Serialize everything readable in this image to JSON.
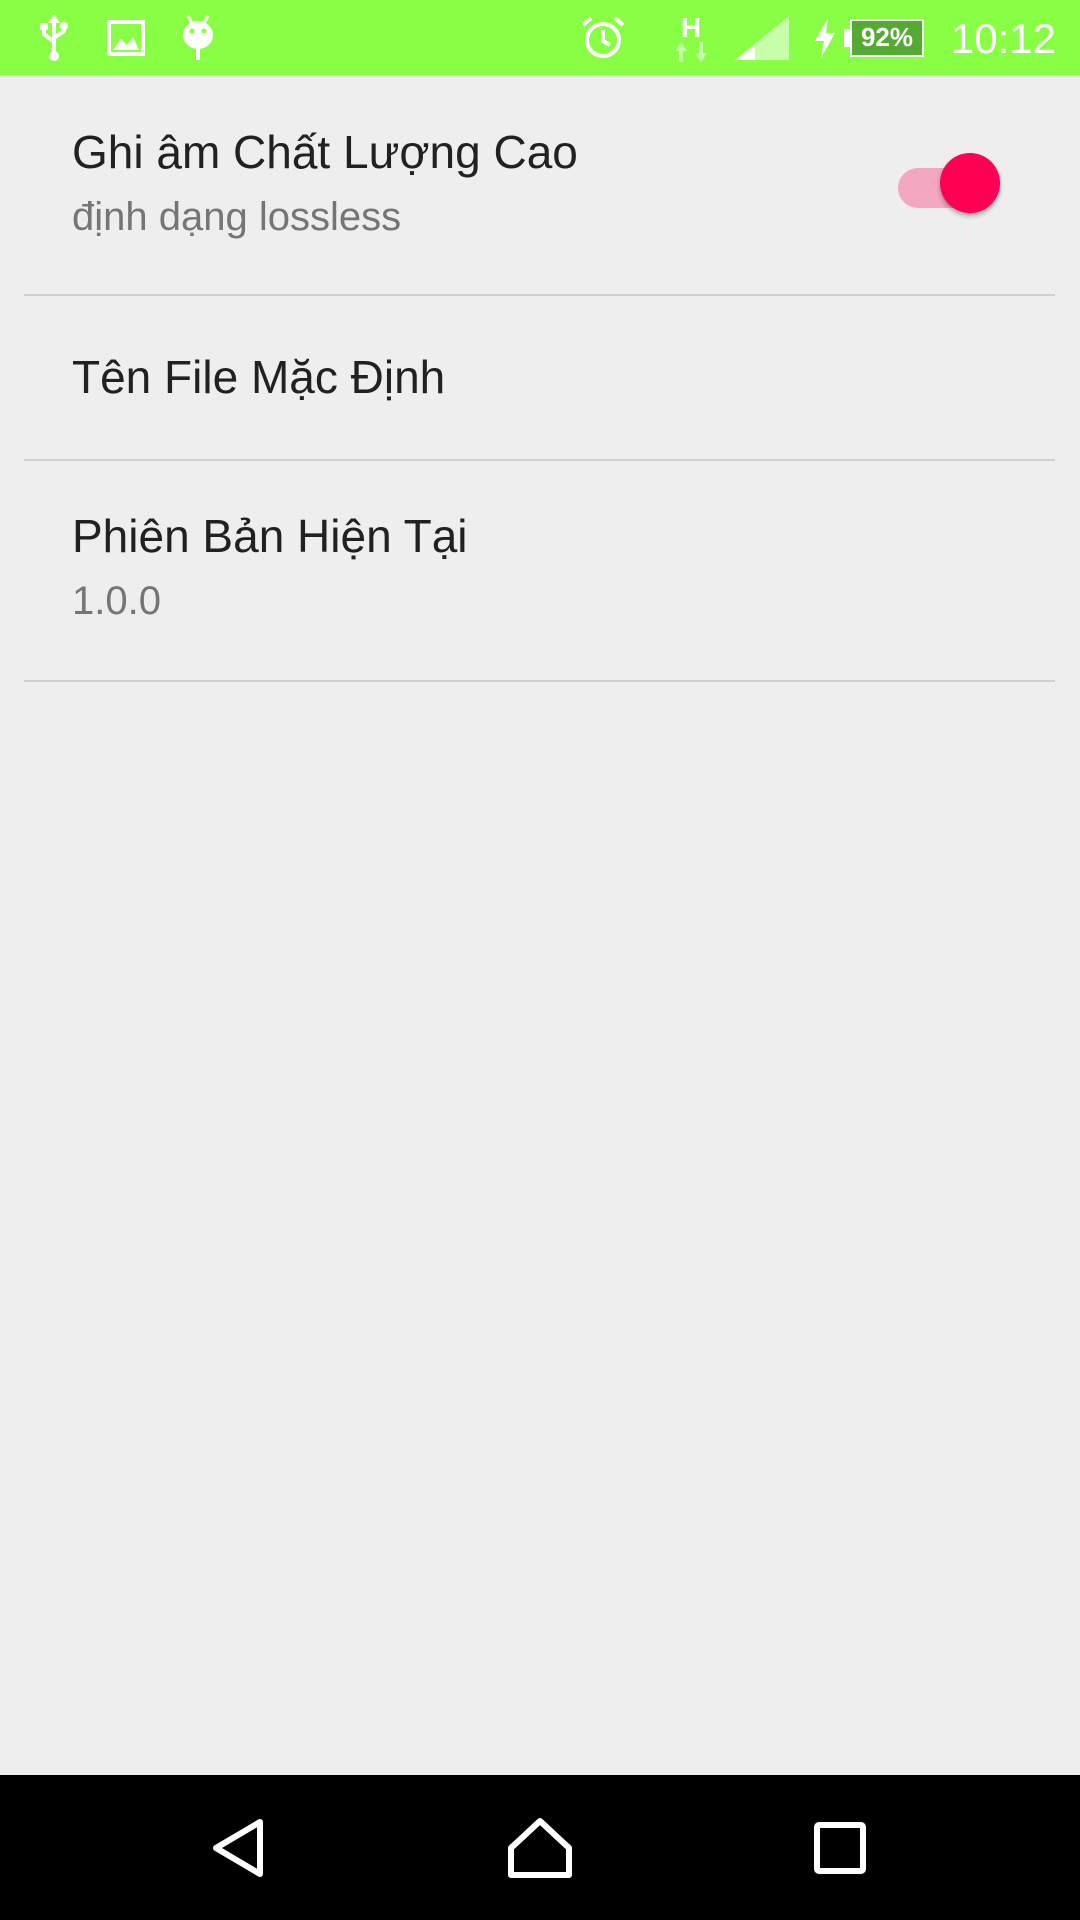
{
  "status_bar": {
    "background": "#88ff44",
    "left_icons": [
      "usb-icon",
      "image-icon",
      "android-debug-icon"
    ],
    "right_icons": [
      "alarm-icon",
      "network-h-icon",
      "signal-icon",
      "charging-icon",
      "battery-icon"
    ],
    "network_type": "H",
    "battery_percent": "92%",
    "time": "10:12"
  },
  "settings": {
    "items": [
      {
        "title": "Ghi âm Chất Lượng Cao",
        "summary": "định dạng lossless",
        "switch_on": true
      },
      {
        "title": "Tên File Mặc Định"
      },
      {
        "title": "Phiên Bản Hiện Tại",
        "summary": "1.0.0"
      }
    ]
  },
  "colors": {
    "switch_thumb": "#ff0055",
    "switch_track": "#f4a7c0",
    "background": "#eeeeee",
    "title_text": "#212121",
    "summary_text": "#757575"
  },
  "nav_bar": {
    "buttons": [
      "back-icon",
      "home-icon",
      "recents-icon"
    ]
  }
}
